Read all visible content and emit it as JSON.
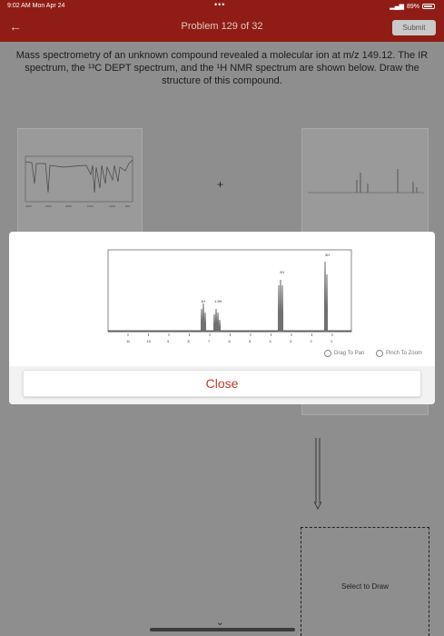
{
  "status_bar": {
    "time": "9:02 AM  Mon Apr 24",
    "dots": "•••",
    "battery": "89%"
  },
  "header": {
    "title": "Problem 129 of 32",
    "submit_label": "Submit"
  },
  "question": {
    "text": "Mass spectrometry of an unknown compound revealed a molecular ion at m/z 149.12. The IR spectrum, the ¹³C DEPT spectrum, and the ¹H NMR spectrum are shown below. Draw the structure of this compound."
  },
  "plus_sign": "+",
  "modal": {
    "nmr_peak_labels": [
      "3H",
      "2H",
      "1H",
      "1.5H"
    ],
    "nmr_axis_ticks": [
      "11",
      "10",
      "9",
      "8",
      "7",
      "6",
      "5",
      "4",
      "3",
      "2",
      "1"
    ],
    "drag_hint": "Drag To Pan",
    "pinch_hint": "Pinch To Zoom",
    "close_label": "Close"
  },
  "draw_area": {
    "label": "Select to Draw"
  },
  "colors": {
    "header_bg": "#8f1d15",
    "close_text": "#c0392b",
    "backdrop": "#8e8e8e"
  }
}
